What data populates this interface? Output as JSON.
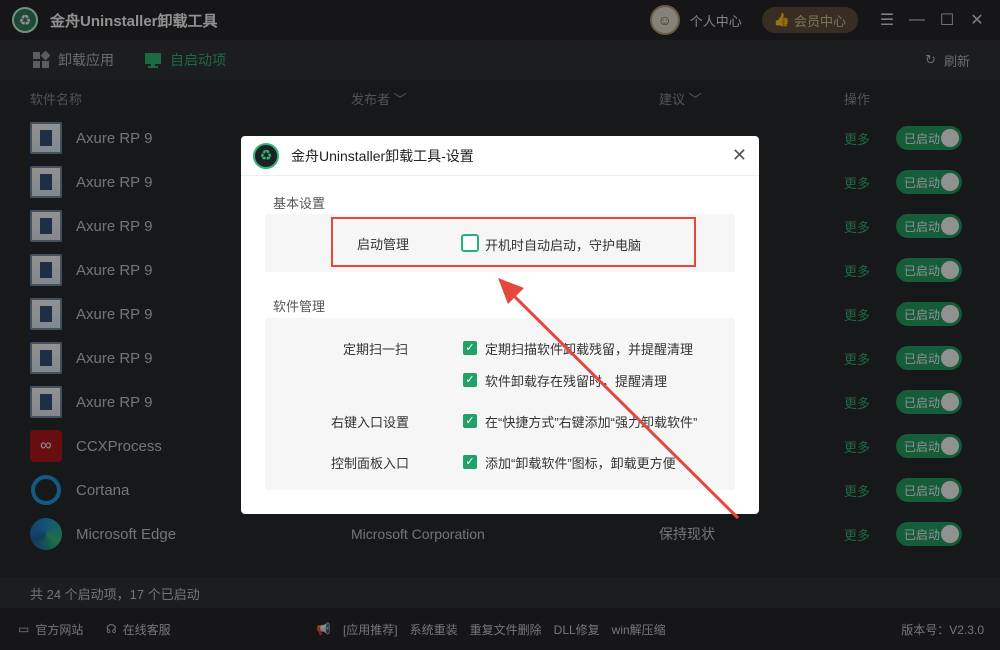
{
  "app": {
    "title": "金舟Uninstaller卸载工具",
    "user_center": "个人中心",
    "vip_center": "会员中心",
    "window_controls": {
      "menu": "☰",
      "min": "—",
      "max": "☐",
      "close": "✕"
    }
  },
  "toolbar": {
    "tabs": [
      {
        "label": "卸载应用",
        "icon": "grid-icon",
        "active": false
      },
      {
        "label": "自启动项",
        "icon": "monitor-icon",
        "active": true
      }
    ],
    "refresh_label": "刷新"
  },
  "columns": {
    "name": "软件名称",
    "publisher": "发布者",
    "advice": "建议",
    "action": "操作"
  },
  "rows": [
    {
      "name": "Axure RP 9",
      "publisher": "",
      "advice": "",
      "more": "更多",
      "toggle": "已启动",
      "icon": "axure"
    },
    {
      "name": "Axure RP 9",
      "publisher": "",
      "advice": "",
      "more": "更多",
      "toggle": "已启动",
      "icon": "axure"
    },
    {
      "name": "Axure RP 9",
      "publisher": "",
      "advice": "",
      "more": "更多",
      "toggle": "已启动",
      "icon": "axure"
    },
    {
      "name": "Axure RP 9",
      "publisher": "",
      "advice": "",
      "more": "更多",
      "toggle": "已启动",
      "icon": "axure"
    },
    {
      "name": "Axure RP 9",
      "publisher": "",
      "advice": "",
      "more": "更多",
      "toggle": "已启动",
      "icon": "axure"
    },
    {
      "name": "Axure RP 9",
      "publisher": "",
      "advice": "",
      "more": "更多",
      "toggle": "已启动",
      "icon": "axure"
    },
    {
      "name": "Axure RP 9",
      "publisher": "",
      "advice": "",
      "more": "更多",
      "toggle": "已启动",
      "icon": "axure"
    },
    {
      "name": "CCXProcess",
      "publisher": "",
      "advice": "",
      "more": "更多",
      "toggle": "已启动",
      "icon": "ccx"
    },
    {
      "name": "Cortana",
      "publisher": "",
      "advice": "",
      "more": "更多",
      "toggle": "已启动",
      "icon": "cortana"
    },
    {
      "name": "Microsoft Edge",
      "publisher": "Microsoft Corporation",
      "advice": "保持现状",
      "more": "更多",
      "toggle": "已启动",
      "icon": "edge"
    }
  ],
  "status": "共 24 个启动项，17 个已启动",
  "footer": {
    "website": "官方网站",
    "support": "在线客服",
    "tools": [
      "[应用推荐]",
      "系统重装",
      "重复文件删除",
      "DLL修复",
      "win解压缩"
    ],
    "version": "版本号：V2.3.0"
  },
  "dialog": {
    "title": "金舟Uninstaller卸载工具-设置",
    "basic_section": "基本设置",
    "startup_label": "启动管理",
    "startup_option": "开机时自动启动，守护电脑",
    "software_section": "软件管理",
    "scan_label": "定期扫一扫",
    "scan_option_1": "定期扫描软件卸载残留，并提醒清理",
    "scan_option_2": "软件卸载存在残留时，提醒清理",
    "context_label": "右键入口设置",
    "context_option": "在“快捷方式”右键添加“强力卸载软件”",
    "panel_label": "控制面板入口",
    "panel_option": "添加“卸载软件”图标，卸载更方便"
  },
  "colors": {
    "accent": "#2bb673",
    "toggle_on": "#1e9e60",
    "highlight": "#e5473d",
    "background": "#222326"
  }
}
